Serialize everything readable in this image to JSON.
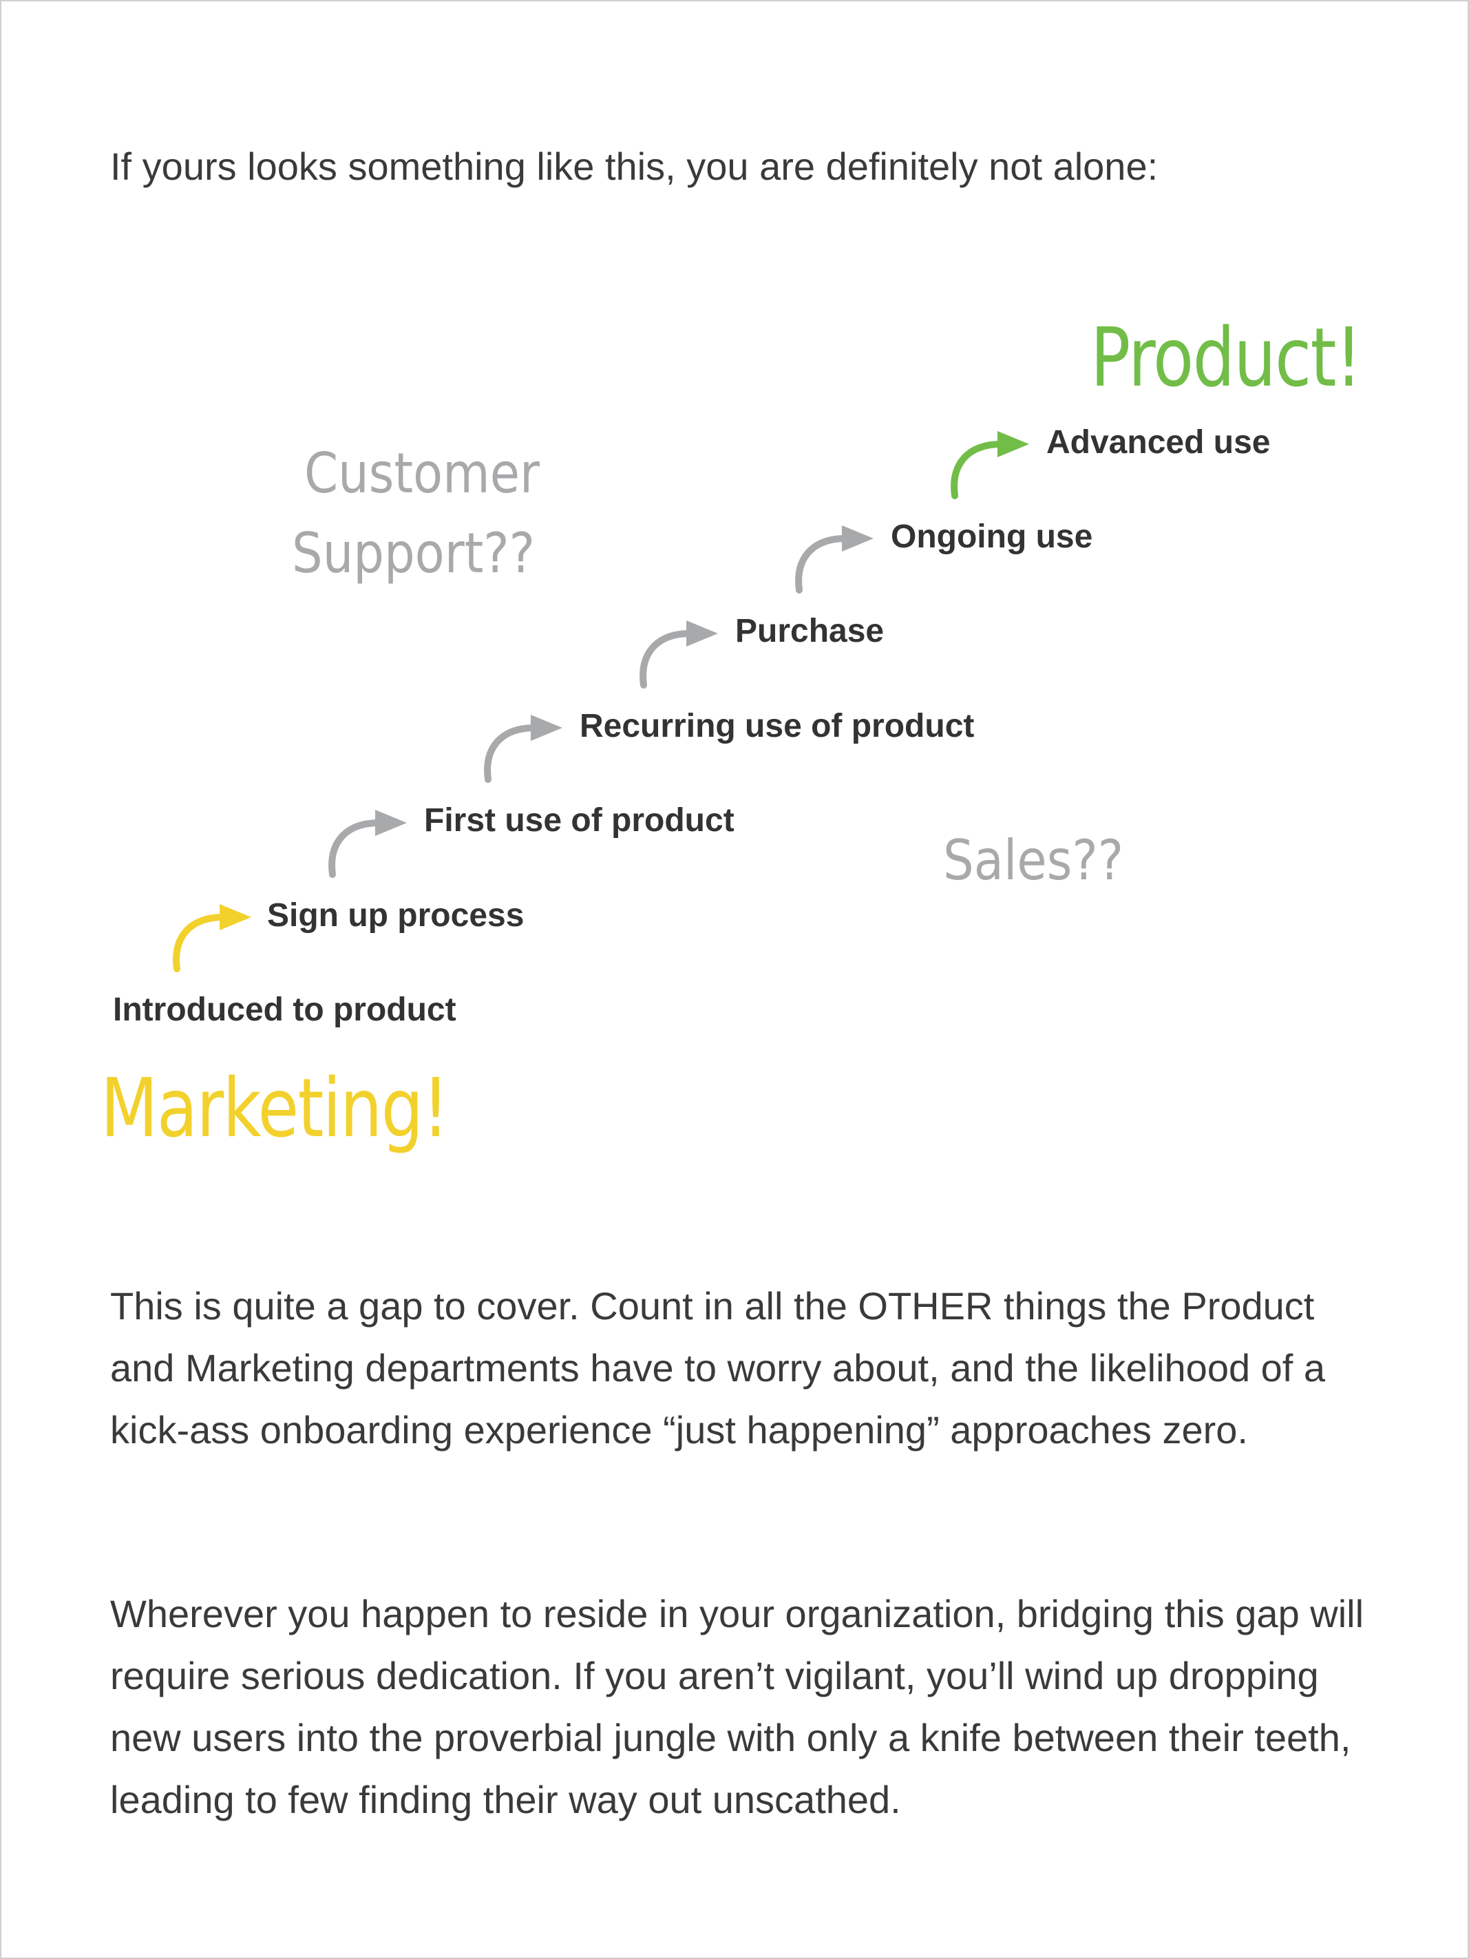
{
  "intro": "If yours looks something like this, you are definitely not alone:",
  "diagram": {
    "steps": [
      "Introduced to product",
      "Sign up process",
      "First use of product",
      "Recurring use of product",
      "Purchase",
      "Ongoing use",
      "Advanced use"
    ],
    "labels": {
      "product": "Product!",
      "marketing": "Marketing!",
      "customer_support_line1": "Customer",
      "customer_support_line2": "Support??",
      "sales": "Sales??"
    },
    "colors": {
      "marketing": "#f2d12c",
      "product": "#72bd48",
      "neutral": "#a7a9ab",
      "step_text": "#333333"
    }
  },
  "paragraphs": [
    "This is quite a gap to cover. Count in all the OTHER things the Product and Marketing departments have to worry about, and the likelihood of a kick-ass onboarding experience “just happening” approaches zero.",
    "Wherever you happen to reside in your organization, bridging this gap will require serious dedication. If you aren’t vigilant, you’ll wind up dropping new users into the proverbial jungle with only a knife between their teeth, leading to few finding their way out unscathed."
  ]
}
